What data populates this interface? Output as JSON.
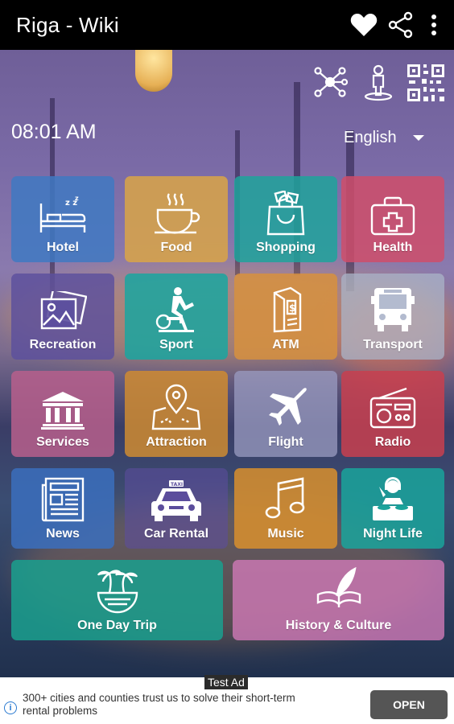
{
  "app": {
    "title": "Riga - Wiki"
  },
  "toolbar": {
    "favorite_icon": "heart-icon",
    "share_icon": "share-icon",
    "menu_icon": "more-vert-icon"
  },
  "header": {
    "time": "08:01 AM",
    "icons": [
      "network-icon",
      "person-location-icon",
      "qr-code-icon"
    ],
    "language": "English"
  },
  "tiles": [
    {
      "label": "Hotel",
      "color": "#3f79c2",
      "icon": "bed-icon"
    },
    {
      "label": "Food",
      "color": "#d9a546",
      "icon": "coffee-cup-icon"
    },
    {
      "label": "Shopping",
      "color": "#1ea39b",
      "icon": "shopping-bag-icon"
    },
    {
      "label": "Health",
      "color": "#cf4d6a",
      "icon": "first-aid-kit-icon"
    },
    {
      "label": "Recreation",
      "color": "#5c4f9e",
      "icon": "picture-icon"
    },
    {
      "label": "Sport",
      "color": "#1aa6a0",
      "icon": "exercise-bike-icon"
    },
    {
      "label": "ATM",
      "color": "#d7913e",
      "icon": "atm-machine-icon"
    },
    {
      "label": "Transport",
      "color": "#9ea9c0",
      "icon": "bus-icon"
    },
    {
      "label": "Services",
      "color": "#b75f8c",
      "icon": "bank-building-icon"
    },
    {
      "label": "Attraction",
      "color": "#cf8b31",
      "icon": "map-pin-icon"
    },
    {
      "label": "Flight",
      "color": "#9b9cc1",
      "icon": "airplane-icon"
    },
    {
      "label": "Radio",
      "color": "#c8404f",
      "icon": "radio-icon"
    },
    {
      "label": "News",
      "color": "#3b6fbd",
      "icon": "newspaper-icon"
    },
    {
      "label": "Car Rental",
      "color": "#5b4d9c",
      "icon": "taxi-icon"
    },
    {
      "label": "Music",
      "color": "#d98f2d",
      "icon": "music-note-icon"
    },
    {
      "label": "Night Life",
      "color": "#1aa39b",
      "icon": "dj-icon"
    },
    {
      "label": "One Day Trip",
      "color": "#1aa08e",
      "icon": "palm-island-icon"
    },
    {
      "label": "History & Culture",
      "color": "#cf79b6",
      "icon": "quill-book-icon"
    }
  ],
  "ad": {
    "badge": "Test Ad",
    "text": "300+ cities and counties trust us to solve their short-term rental problems",
    "button": "OPEN",
    "info_icon": "info-icon"
  }
}
